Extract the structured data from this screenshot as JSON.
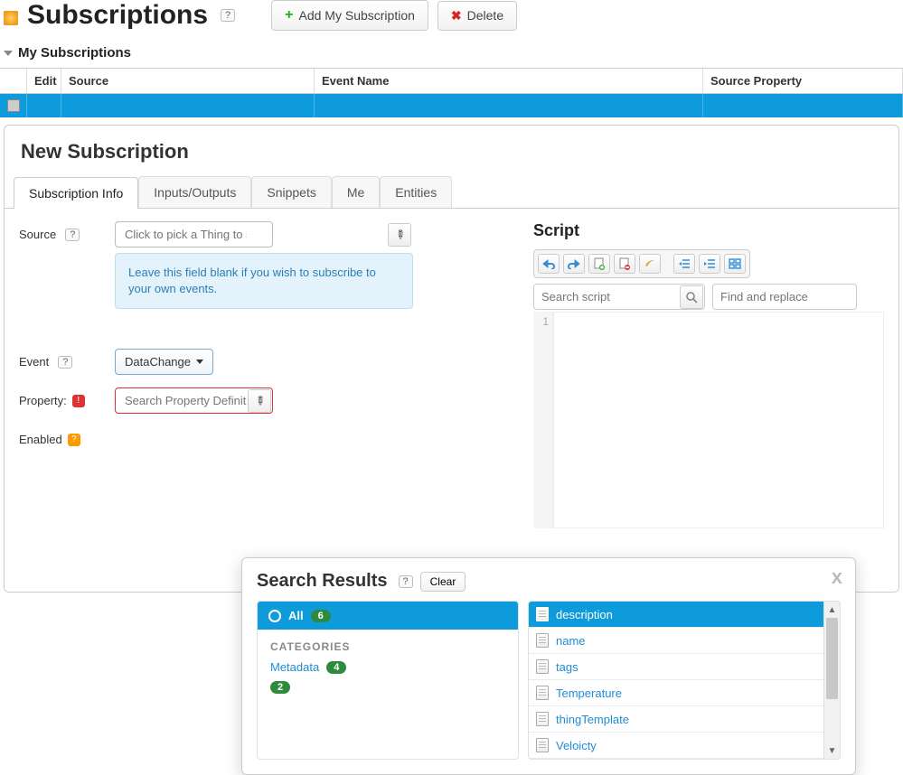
{
  "header": {
    "title": "Subscriptions",
    "add_btn": "Add My Subscription",
    "delete_btn": "Delete"
  },
  "section": {
    "title": "My Subscriptions"
  },
  "grid": {
    "cols": {
      "edit": "Edit",
      "source": "Source",
      "event": "Event Name",
      "property": "Source Property"
    }
  },
  "panel": {
    "title": "New Subscription",
    "tabs": {
      "info": "Subscription Info",
      "io": "Inputs/Outputs",
      "snippets": "Snippets",
      "me": "Me",
      "entities": "Entities"
    },
    "labels": {
      "source": "Source",
      "event": "Event",
      "property": "Property:",
      "enabled": "Enabled"
    },
    "source_placeholder": "Click to pick a Thing to subscribe to",
    "source_hint": "Leave this field blank if you wish to subscribe to your own events.",
    "event_value": "DataChange",
    "property_placeholder": "Search Property Definitions"
  },
  "script": {
    "title": "Script",
    "search_placeholder": "Search script",
    "find_placeholder": "Find and replace",
    "line1": "1"
  },
  "popup": {
    "title": "Search Results",
    "clear": "Clear",
    "all_label": "All",
    "all_count": "6",
    "cat_heading": "CATEGORIES",
    "cat1": "Metadata",
    "cat1_count": "4",
    "cat2_count": "2",
    "results": {
      "r0": "description",
      "r1": "name",
      "r2": "tags",
      "r3": "Temperature",
      "r4": "thingTemplate",
      "r5": "Veloicty"
    }
  }
}
